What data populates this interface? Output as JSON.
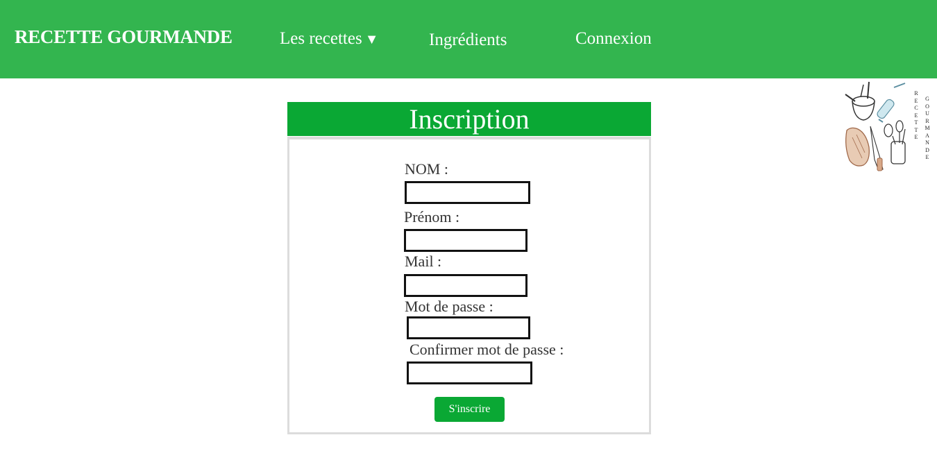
{
  "nav": {
    "brand": "RECETTE GOURMANDE",
    "recettes_label": "Les recettes",
    "recettes_caret": "▼",
    "ingredients_label": "Ingrédients",
    "connexion_label": "Connexion",
    "bg_color": "#33b54f"
  },
  "logo": {
    "word1": "RECETTE",
    "word2": "GOURMANDE",
    "icon": "kitchen-utensils-icon"
  },
  "form": {
    "title": "Inscription",
    "accent_color": "#0aa834",
    "fields": [
      {
        "label": "NOM :",
        "value": ""
      },
      {
        "label": "Prénom :",
        "value": ""
      },
      {
        "label": "Mail :",
        "value": ""
      },
      {
        "label": "Mot de passe :",
        "value": ""
      },
      {
        "label": "Confirmer mot de passe :",
        "value": ""
      }
    ],
    "submit_label": "S'inscrire"
  }
}
